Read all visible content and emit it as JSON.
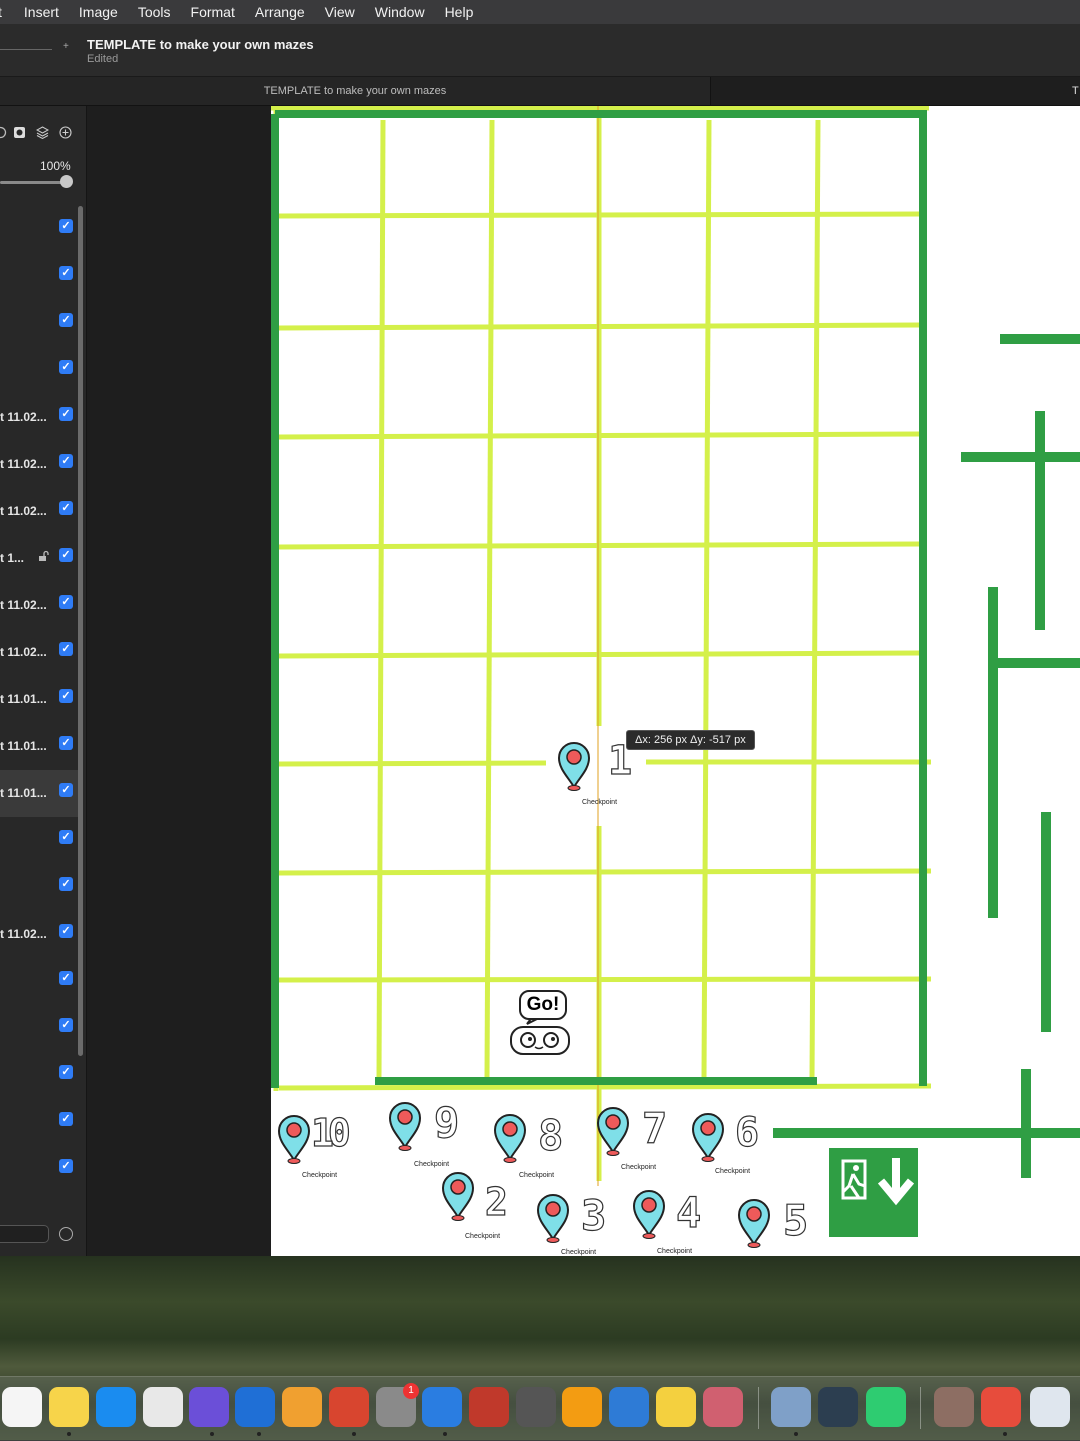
{
  "menubar": {
    "items": [
      "t",
      "Insert",
      "Image",
      "Tools",
      "Format",
      "Arrange",
      "View",
      "Window",
      "Help"
    ]
  },
  "toolbar": {
    "title": "TEMPLATE to make your own mazes",
    "status": "Edited",
    "zoom_plus": "+"
  },
  "tabs": {
    "active": "TEMPLATE to make your own mazes",
    "other": "T"
  },
  "sidebar": {
    "opacity": "100%",
    "layers": [
      {
        "name": "",
        "checked": true
      },
      {
        "name": "",
        "checked": true
      },
      {
        "name": "",
        "checked": true
      },
      {
        "name": "",
        "checked": true
      },
      {
        "name": "t 11.02...",
        "checked": true
      },
      {
        "name": "t 11.02...",
        "checked": true
      },
      {
        "name": "t 11.02...",
        "checked": true
      },
      {
        "name": "t 1...",
        "checked": true,
        "locked": false
      },
      {
        "name": "t 11.02...",
        "checked": true
      },
      {
        "name": "t 11.02...",
        "checked": true
      },
      {
        "name": "t 11.01...",
        "checked": true
      },
      {
        "name": "t 11.01...",
        "checked": true
      },
      {
        "name": "t 11.01...",
        "checked": true,
        "selected": true
      },
      {
        "name": "",
        "checked": true
      },
      {
        "name": "",
        "checked": true
      },
      {
        "name": "t 11.02...",
        "checked": true
      },
      {
        "name": "",
        "checked": true
      },
      {
        "name": "",
        "checked": true
      },
      {
        "name": "",
        "checked": true
      },
      {
        "name": "",
        "checked": true
      },
      {
        "name": "",
        "checked": true
      }
    ]
  },
  "canvas": {
    "tooltip": "Δx: 256 px Δy: -517 px",
    "go_label": "Go!",
    "checkpoint_label": "Checkpoint",
    "checkpoints": [
      "1",
      "10",
      "9",
      "8",
      "7",
      "6",
      "2",
      "3",
      "4",
      "5"
    ],
    "grid_color": "#d4f04a",
    "wall_color": "#2f9e44",
    "pin_color": "#7fdfe8",
    "pin_dot_color": "#ee5a5a",
    "exit_sign_color": "#2f9e44"
  },
  "dock": {
    "badge": "1",
    "icons": [
      "reminders-icon",
      "notes-icon",
      "app-store-icon",
      "chrome-icon",
      "imovie-icon",
      "scrivener-icon",
      "pixelmator-icon",
      "affinity-icon",
      "system-settings-icon",
      "focus-icon",
      "rocket-icon",
      "calculator-icon",
      "pages-icon",
      "keynote-icon",
      "spike-icon",
      "iphone-mirroring-icon",
      "preview-icon",
      "quicktime-icon",
      "numbers-icon",
      "photos-stack-icon",
      "affinity-designer-icon",
      "keyboard-viewer-icon"
    ]
  }
}
